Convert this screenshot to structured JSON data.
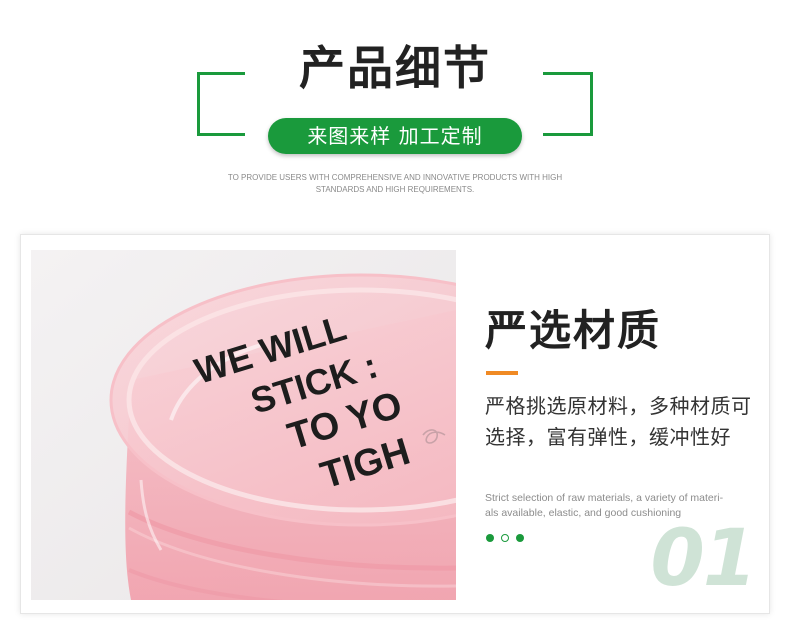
{
  "header": {
    "title": "产品细节",
    "subtitle": "来图来样 加工定制",
    "english_line1": "TO PROVIDE USERS WITH COMPREHENSIVE AND INNOVATIVE PRODUCTS WITH HIGH",
    "english_line2": "STANDARDS AND HIGH REQUIREMENTS.",
    "accent_color": "#1a9a3c"
  },
  "photo": {
    "description_icon": "pink-transparent-pouch-photo",
    "printed_lines": [
      "WE WILL",
      "STICK :",
      "TO YO",
      "TIGH"
    ]
  },
  "feature": {
    "title": "严选材质",
    "description": "严格挑选原材料，多种材质可选择，富有弹性，缓冲性好",
    "english_line1": "Strict selection of raw materials, a variety of materi-",
    "english_line2": "als available, elastic, and good cushioning",
    "number": "01",
    "underline_color": "#f08a24",
    "number_color": "#cfe3d6"
  },
  "pagination": {
    "total": 3,
    "active_states": [
      "filled",
      "hollow",
      "filled"
    ]
  }
}
